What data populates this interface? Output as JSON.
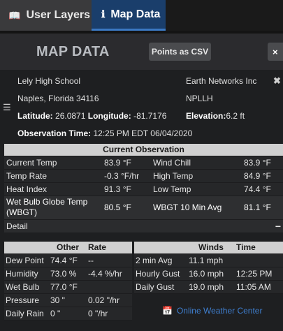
{
  "tabs": [
    {
      "label": "User Layers",
      "icon": "book-map-icon"
    },
    {
      "label": "Map Data",
      "icon": "info-icon"
    }
  ],
  "header": {
    "title": "MAP DATA",
    "csv_button": "Points as CSV",
    "close": "×"
  },
  "station": {
    "name": "Lely High School",
    "city": "Naples, Florida 34116",
    "latitude_label": "Latitude:",
    "latitude": "26.0871",
    "longitude_label": "Longitude:",
    "longitude": "-81.7176",
    "obs_time_label": "Observation Time:",
    "obs_time": "12:25 PM EDT 06/04/2020",
    "provider": "Earth Networks Inc",
    "station_id": "NPLLH",
    "elevation_label": "Elevation:",
    "elevation": "6.2 ft",
    "close": "✖"
  },
  "current": {
    "title": "Current Observation",
    "rows": [
      [
        "Current Temp",
        "83.9 °F",
        "Wind Chill",
        "83.9 °F"
      ],
      [
        "Temp Rate",
        "-0.3 °F/hr",
        "High Temp",
        "84.9 °F"
      ],
      [
        "Heat Index",
        "91.3 °F",
        "Low Temp",
        "74.4 °F"
      ]
    ],
    "wbgt": [
      "Wet Bulb Globe Temp (WBGT)",
      "80.5 °F",
      "WBGT 10 Min Avg",
      "81.1 °F"
    ],
    "detail_label": "Detail",
    "detail_toggle": "−"
  },
  "other": {
    "headers": [
      "",
      "Other",
      "Rate"
    ],
    "rows": [
      [
        "Dew Point",
        "74.4 °F",
        "--"
      ],
      [
        "Humidity",
        "73.0 %",
        "-4.4 %/hr"
      ],
      [
        "Wet Bulb",
        "77.0 °F",
        ""
      ],
      [
        "Pressure",
        "30 \"",
        "0.02 \"/hr"
      ],
      [
        "Daily Rain",
        "0 \"",
        "0 \"/hr"
      ]
    ]
  },
  "winds": {
    "headers": [
      "",
      "Winds",
      "Time"
    ],
    "rows": [
      [
        "2 min Avg",
        "11.1 mph",
        ""
      ],
      [
        "Hourly Gust",
        "16.0 mph",
        "12:25 PM"
      ],
      [
        "Daily Gust",
        "19.0 mph",
        "11:05 AM"
      ]
    ]
  },
  "link": {
    "label": "Online Weather Center",
    "icon": "calendar-icon"
  },
  "colors": {
    "accent": "#1a3e6b",
    "link": "#3f7fd0"
  }
}
